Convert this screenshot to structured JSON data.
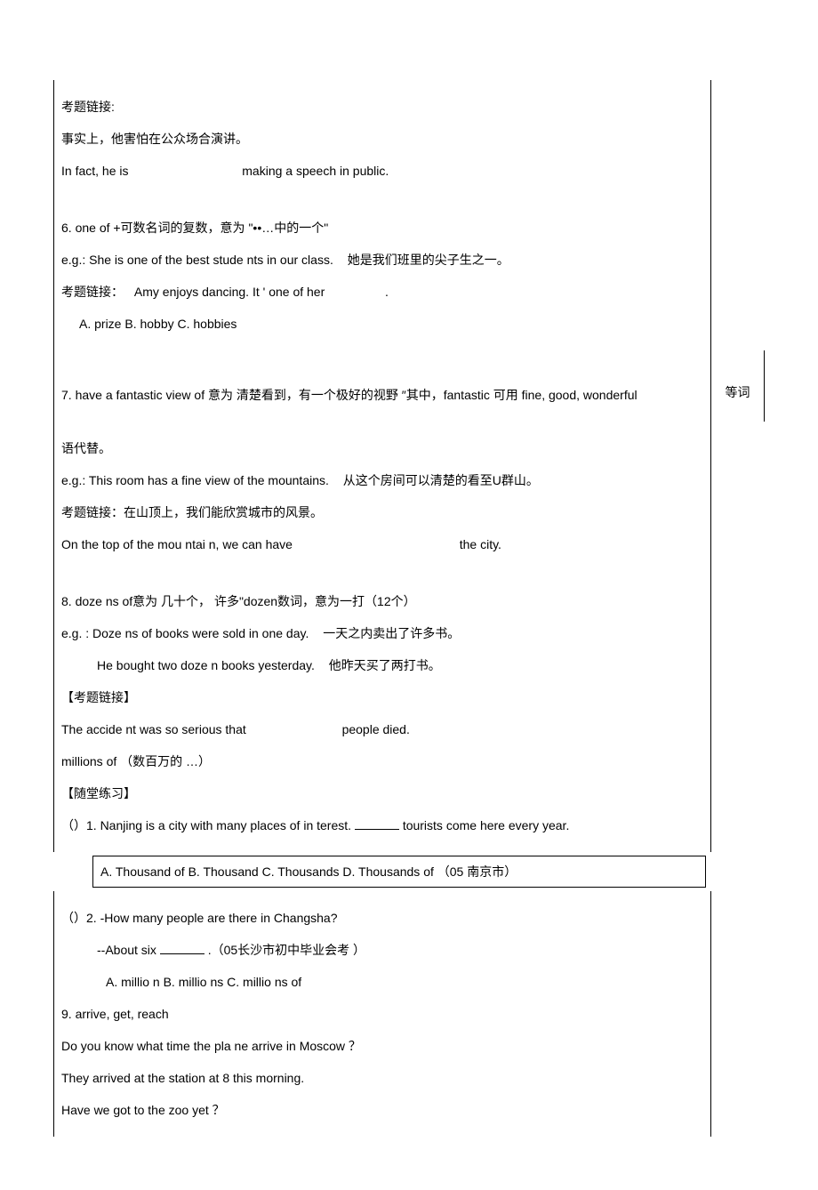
{
  "section5": {
    "link_label": "考题链接:",
    "prompt_cn": "事实上，他害怕在公众场合演讲。",
    "sentence_pre": "In fact, he is",
    "sentence_post": "making a speech in public."
  },
  "section6": {
    "header": "6.  one of +可数名词的复数，意为      \"••…中的一个\"",
    "eg_en": "e.g.: She is one of the best stude nts in our class.",
    "eg_cn": "她是我们班里的尖子生之一。",
    "link_label": "考题链接：",
    "link_text": "Amy enjoys dancing. It ' one of her",
    "link_suffix": ".",
    "options": "A. prize B. hobby C. hobbies"
  },
  "section7": {
    "header_pre": "7.  have a fantastic view of 意为 清楚看到，有一个极好的视野      ″其中，fantastic 可用 fine, good, wonderful",
    "header_side": "等词",
    "header_post": "语代替。",
    "eg_en": "e.g.: This room has a fine view of the mountains.",
    "eg_cn": "从这个房间可以清楚的看至U群山。",
    "link_label": "考题链接：在山顶上，我们能欣赏城市的风景。",
    "sentence_pre": "On the top of the mou ntai n, we can have",
    "sentence_post": "the city."
  },
  "section8": {
    "header": "8.  doze ns of意为 几十个，   许多\"dozen数词，意为一打（12个）",
    "eg1_en": "e.g. : Doze ns of books were sold in one day.",
    "eg1_cn": "一天之内卖出了许多书。",
    "eg2_en": "He bought two doze n books yesterday.",
    "eg2_cn": "他昨天买了两打书。",
    "link_label": "【考题链接】",
    "sentence_pre": "The accide nt was so serious that",
    "sentence_post": "people died.",
    "note": "millions of （数百万的 …）",
    "exercise_label": "【随堂练习】",
    "q1_pre": "（）1. Nanjing is a city with many places of in terest.",
    "q1_post": "tourists come here every year.",
    "q1_options": "A. Thousand of B. Thousand C. Thousands D. Thousands of （05 南京市）"
  },
  "section_q2": {
    "q2_line1": "（）2. -How many people are there in Changsha?",
    "q2_line2_pre": "--About six",
    "q2_line2_post": ".（05长沙市初中毕业会考 ）",
    "q2_options": "A. millio n B. millio ns C. millio ns of"
  },
  "section9": {
    "header": "9.  arrive, get, reach",
    "line1": "Do you know what time the pla ne arrive in Moscow ？",
    "line2": "They arrived at the station at 8 this morning.",
    "line3": "Have we got to the zoo yet ？"
  }
}
